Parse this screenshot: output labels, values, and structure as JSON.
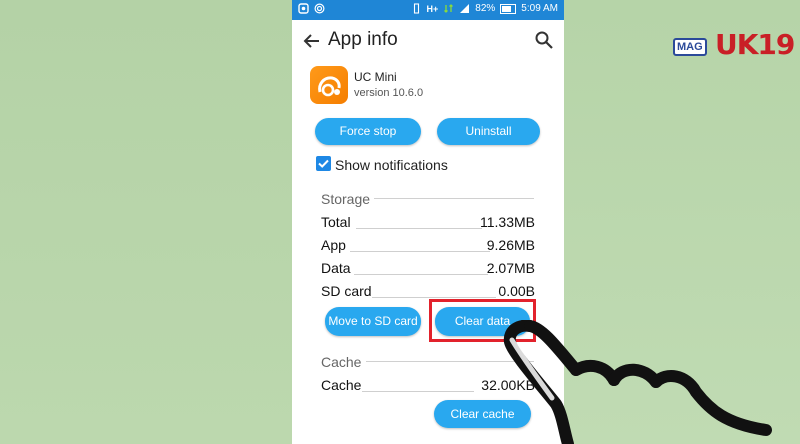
{
  "status_bar": {
    "battery": "82%",
    "time": "5:09 AM",
    "network": "H+"
  },
  "appbar": {
    "title": "App info"
  },
  "app": {
    "name": "UC Mini",
    "version": "version 10.6.0"
  },
  "buttons": {
    "force_stop": "Force stop",
    "uninstall": "Uninstall",
    "move_to_sd": "Move to SD card",
    "clear_data": "Clear data",
    "clear_cache": "Clear cache"
  },
  "notifications": {
    "label": "Show notifications",
    "checked": true
  },
  "storage": {
    "header": "Storage",
    "rows": [
      {
        "label": "Total",
        "value": "11.33MB"
      },
      {
        "label": "App",
        "value": "9.26MB"
      },
      {
        "label": "Data",
        "value": "2.07MB"
      },
      {
        "label": "SD card",
        "value": "0.00B"
      }
    ]
  },
  "cache": {
    "header": "Cache",
    "label": "Cache",
    "value": "32.00KB"
  },
  "watermark": {
    "mag": "MAG",
    "brand": "UK19"
  },
  "colors": {
    "status_bar": "#1f86d6",
    "button": "#29a8ef",
    "highlight": "#e2222c",
    "background": "#b9d6ab"
  }
}
